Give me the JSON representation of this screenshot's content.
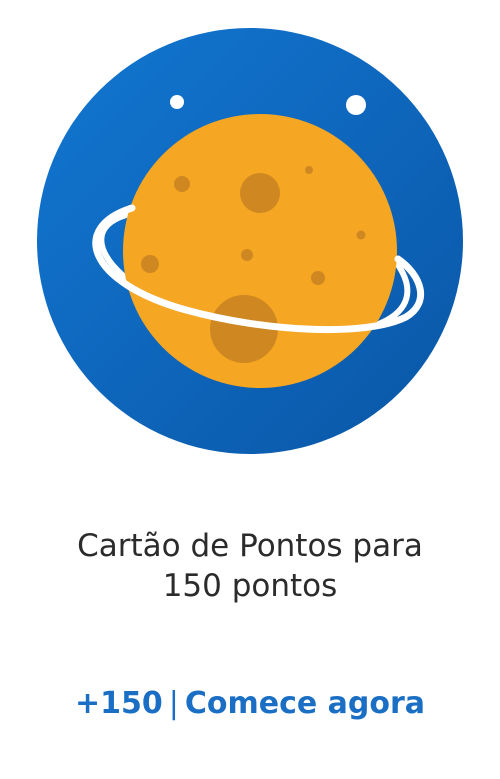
{
  "card": {
    "title_line1": "Cartão de Pontos para",
    "title_line2": "150 pontos",
    "points": "+150",
    "separator": "|",
    "action": "Comece agora",
    "illustration_icon": "planet-icon"
  },
  "colors": {
    "circle_blue": "#0f6cc4",
    "circle_blue_dark": "#0a56a6",
    "planet_orange": "#f5a623",
    "crater": "#cf8721",
    "ring": "#ffffff",
    "title_text": "#2b2b2b",
    "link": "#1a6fc5"
  }
}
